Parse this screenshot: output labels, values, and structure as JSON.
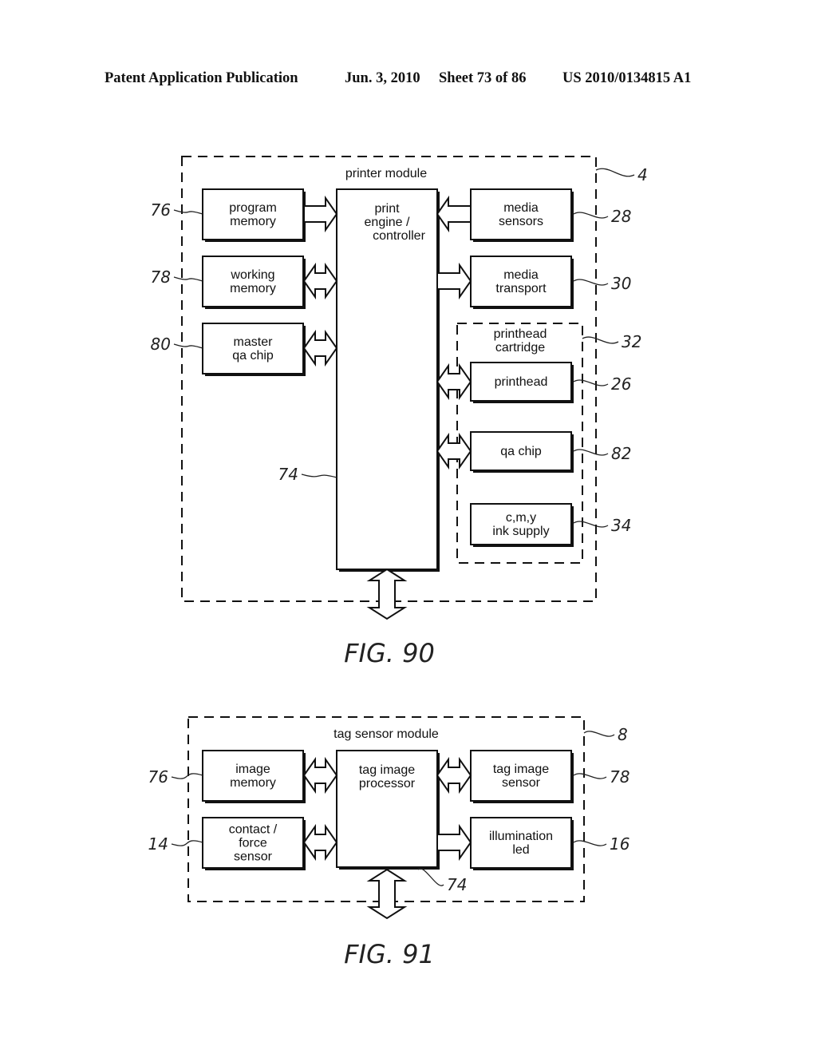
{
  "header": {
    "publication": "Patent Application Publication",
    "date": "Jun. 3, 2010",
    "sheet": "Sheet 73 of 86",
    "number": "US 2010/0134815 A1"
  },
  "fig90": {
    "caption": "FIG. 90",
    "module": {
      "title": "printer module",
      "ref": "4"
    },
    "controller": {
      "lines": [
        "print",
        "engine /",
        "controller"
      ],
      "ref": "74"
    },
    "left_blocks": [
      {
        "id": "program-memory",
        "lines": [
          "program",
          "memory"
        ],
        "ref": "76",
        "arrow": "to-controller"
      },
      {
        "id": "working-memory",
        "lines": [
          "working",
          "memory"
        ],
        "ref": "78",
        "arrow": "bidirectional"
      },
      {
        "id": "master-qa-chip",
        "lines": [
          "master",
          "qa chip"
        ],
        "ref": "80",
        "arrow": "bidirectional"
      }
    ],
    "right_blocks": [
      {
        "id": "media-sensors",
        "lines": [
          "media",
          "sensors"
        ],
        "ref": "28",
        "arrow": "to-controller"
      },
      {
        "id": "media-transport",
        "lines": [
          "media",
          "transport"
        ],
        "ref": "30",
        "arrow": "from-controller"
      }
    ],
    "cartridge": {
      "title_lines": [
        "printhead",
        "cartridge"
      ],
      "ref": "32",
      "blocks": [
        {
          "id": "printhead",
          "lines": [
            "printhead"
          ],
          "ref": "26",
          "arrow": "bidirectional"
        },
        {
          "id": "qa-chip",
          "lines": [
            "qa chip"
          ],
          "ref": "82",
          "arrow": "bidirectional"
        },
        {
          "id": "ink-supply",
          "lines": [
            "c,m,y",
            "ink supply"
          ],
          "ref": "34",
          "arrow": "none"
        }
      ]
    },
    "bus_arrow": "bidirectional"
  },
  "fig91": {
    "caption": "FIG. 91",
    "module": {
      "title": "tag sensor module",
      "ref": "8"
    },
    "processor": {
      "lines": [
        "tag image",
        "processor"
      ],
      "ref": "74"
    },
    "left_blocks": [
      {
        "id": "image-memory",
        "lines": [
          "image",
          "memory"
        ],
        "ref": "76",
        "arrow": "bidirectional"
      },
      {
        "id": "contact-force-sensor",
        "lines": [
          "contact /",
          "force",
          "sensor"
        ],
        "ref": "14",
        "arrow": "bidirectional"
      }
    ],
    "right_blocks": [
      {
        "id": "tag-image-sensor",
        "lines": [
          "tag image",
          "sensor"
        ],
        "ref": "78",
        "arrow": "bidirectional"
      },
      {
        "id": "illumination-led",
        "lines": [
          "illumination",
          "led"
        ],
        "ref": "16",
        "arrow": "from-controller"
      }
    ],
    "bus_arrow": "bidirectional"
  }
}
